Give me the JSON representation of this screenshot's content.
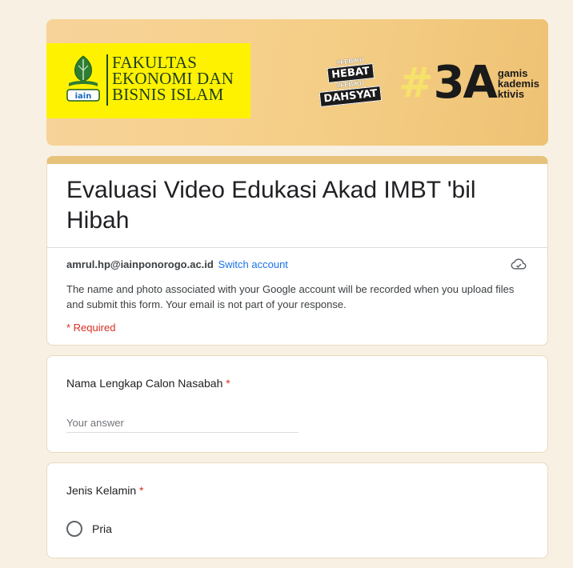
{
  "banner": {
    "logo_lines": [
      "FAKULTAS",
      "EKONOMI DAN",
      "BISNIS ISLAM"
    ],
    "emblem_text": "iain",
    "hashtag_top": "#FEBIKU",
    "hashtag_box1": "HEBAT",
    "hashtag_mid": "#FEBIKU",
    "hashtag_box2": "DAHSYAT",
    "three_a_hash": "#",
    "three_a_main": "3A",
    "three_a_words": [
      "gamis",
      "kademis",
      "ktivis"
    ]
  },
  "form": {
    "title": "Evaluasi Video Edukasi Akad IMBT 'bil Hibah",
    "account_email": "amrul.hp@iainponorogo.ac.id",
    "switch_account": "Switch account",
    "notice": "The name and photo associated with your Google account will be recorded when you upload files and submit this form. Your email is not part of your response.",
    "required_note": "* Required"
  },
  "questions": [
    {
      "label": "Nama Lengkap Calon Nasabah",
      "required_mark": "*",
      "placeholder": "Your answer"
    },
    {
      "label": "Jenis Kelamin",
      "required_mark": "*",
      "options": [
        "Pria"
      ]
    }
  ],
  "colors": {
    "accent": "#e7c27c",
    "background": "#f8f1e3",
    "link": "#1a73e8",
    "required": "#d93025"
  }
}
